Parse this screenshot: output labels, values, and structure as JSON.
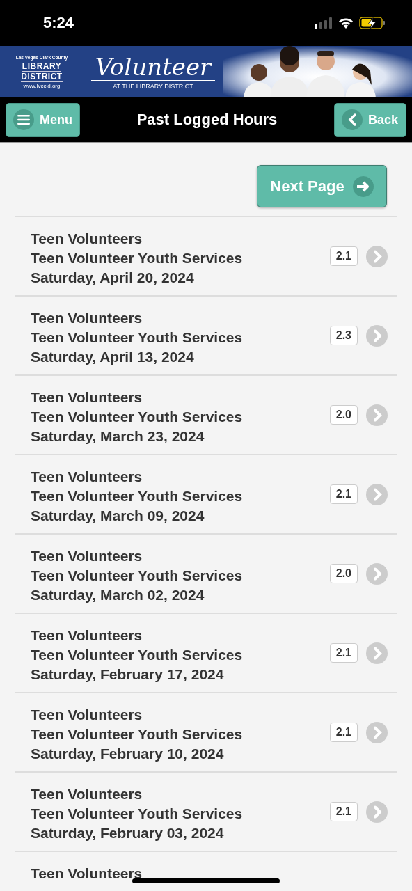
{
  "status_bar": {
    "time": "5:24"
  },
  "banner": {
    "org_small": "Las Vegas-Clark County",
    "org_line_1": "LIBRARY",
    "org_line_2": "DISTRICT",
    "org_url": "www.lvccld.org",
    "title": "Volunteer",
    "subtitle": "AT THE LIBRARY DISTRICT"
  },
  "nav": {
    "menu_button": "Menu",
    "title": "Past Logged Hours",
    "back_button": "Back"
  },
  "next_page_button": "Next Page",
  "entries": [
    {
      "group": "Teen Volunteers",
      "role": "Teen Volunteer Youth Services",
      "date": "Saturday, April 20, 2024",
      "hours": "2.1"
    },
    {
      "group": "Teen Volunteers",
      "role": "Teen Volunteer Youth Services",
      "date": "Saturday, April 13, 2024",
      "hours": "2.3"
    },
    {
      "group": "Teen Volunteers",
      "role": "Teen Volunteer Youth Services",
      "date": "Saturday, March 23, 2024",
      "hours": "2.0"
    },
    {
      "group": "Teen Volunteers",
      "role": "Teen Volunteer Youth Services",
      "date": "Saturday, March 09, 2024",
      "hours": "2.1"
    },
    {
      "group": "Teen Volunteers",
      "role": "Teen Volunteer Youth Services",
      "date": "Saturday, March 02, 2024",
      "hours": "2.0"
    },
    {
      "group": "Teen Volunteers",
      "role": "Teen Volunteer Youth Services",
      "date": "Saturday, February 17, 2024",
      "hours": "2.1"
    },
    {
      "group": "Teen Volunteers",
      "role": "Teen Volunteer Youth Services",
      "date": "Saturday, February 10, 2024",
      "hours": "2.1"
    },
    {
      "group": "Teen Volunteers",
      "role": "Teen Volunteer Youth Services",
      "date": "Saturday, February 03, 2024",
      "hours": "2.1"
    },
    {
      "group": "Teen Volunteers"
    }
  ]
}
